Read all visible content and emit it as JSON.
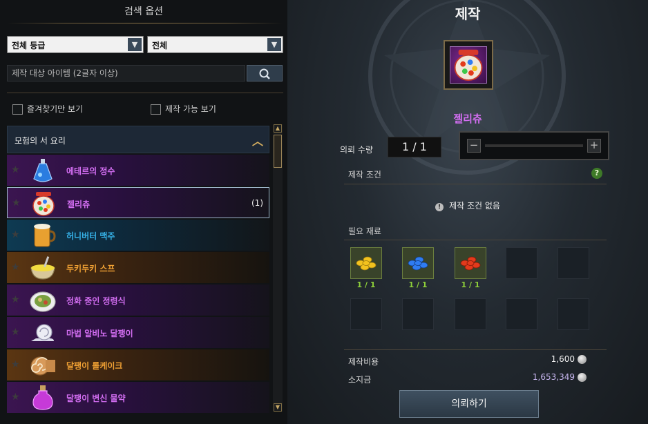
{
  "search": {
    "title": "검색 옵션",
    "grade_dropdown": "전체 등급",
    "category_dropdown": "전체",
    "placeholder": "제작 대상 아이템 (2글자 이상)",
    "favorites_only": "즐겨찾기만 보기",
    "craftable_only": "제작 가능 보기"
  },
  "list": {
    "header": "모험의 서 요리",
    "items": [
      {
        "name": "에테르의 정수",
        "grade": "purple",
        "count": "",
        "icon": "blue-potion-flask-icon"
      },
      {
        "name": "젤리츄",
        "grade": "purple",
        "count": "(1)",
        "icon": "gumball-jar-icon"
      },
      {
        "name": "허니버터 맥주",
        "grade": "blue",
        "count": "",
        "icon": "honey-beer-mug-icon"
      },
      {
        "name": "두키두키 스프",
        "grade": "orange",
        "count": "",
        "icon": "soup-bowl-icon"
      },
      {
        "name": "정화 중인 정령식",
        "grade": "purple",
        "count": "",
        "icon": "salad-plate-icon"
      },
      {
        "name": "마법 알비노 달팽이",
        "grade": "purple",
        "count": "",
        "icon": "white-snail-icon"
      },
      {
        "name": "달팽이 롤케이크",
        "grade": "orange",
        "count": "",
        "icon": "roll-cake-icon"
      },
      {
        "name": "달팽이 변신 물약",
        "grade": "purple",
        "count": "",
        "icon": "pink-potion-bottle-icon"
      }
    ]
  },
  "craft": {
    "title": "제작",
    "item_name": "젤리츄",
    "quantity_label": "의뢰 수량",
    "quantity_value": "1 / 1",
    "conditions_label": "제작 조건",
    "no_conditions": "제작 조건 없음",
    "materials_label": "필요 재료",
    "materials": [
      {
        "icon": "yellow-jelly-beans-icon",
        "count": "1 / 1",
        "color": "#f2c21e"
      },
      {
        "icon": "blue-jelly-beans-icon",
        "count": "1 / 1",
        "color": "#2f7cf2"
      },
      {
        "icon": "red-jelly-beans-icon",
        "count": "1 / 1",
        "color": "#e23a1c"
      }
    ],
    "cost_label": "제작비용",
    "cost_value": "1,600",
    "gold_label": "소지금",
    "gold_value": "1,653,349",
    "request_button": "의뢰하기"
  },
  "colors": {
    "grade_purple": "#d36ef2",
    "grade_blue": "#36b2e8",
    "grade_orange": "#f2a234",
    "gold_value": "#c9b8f2",
    "material_count": "#8fd13a"
  }
}
